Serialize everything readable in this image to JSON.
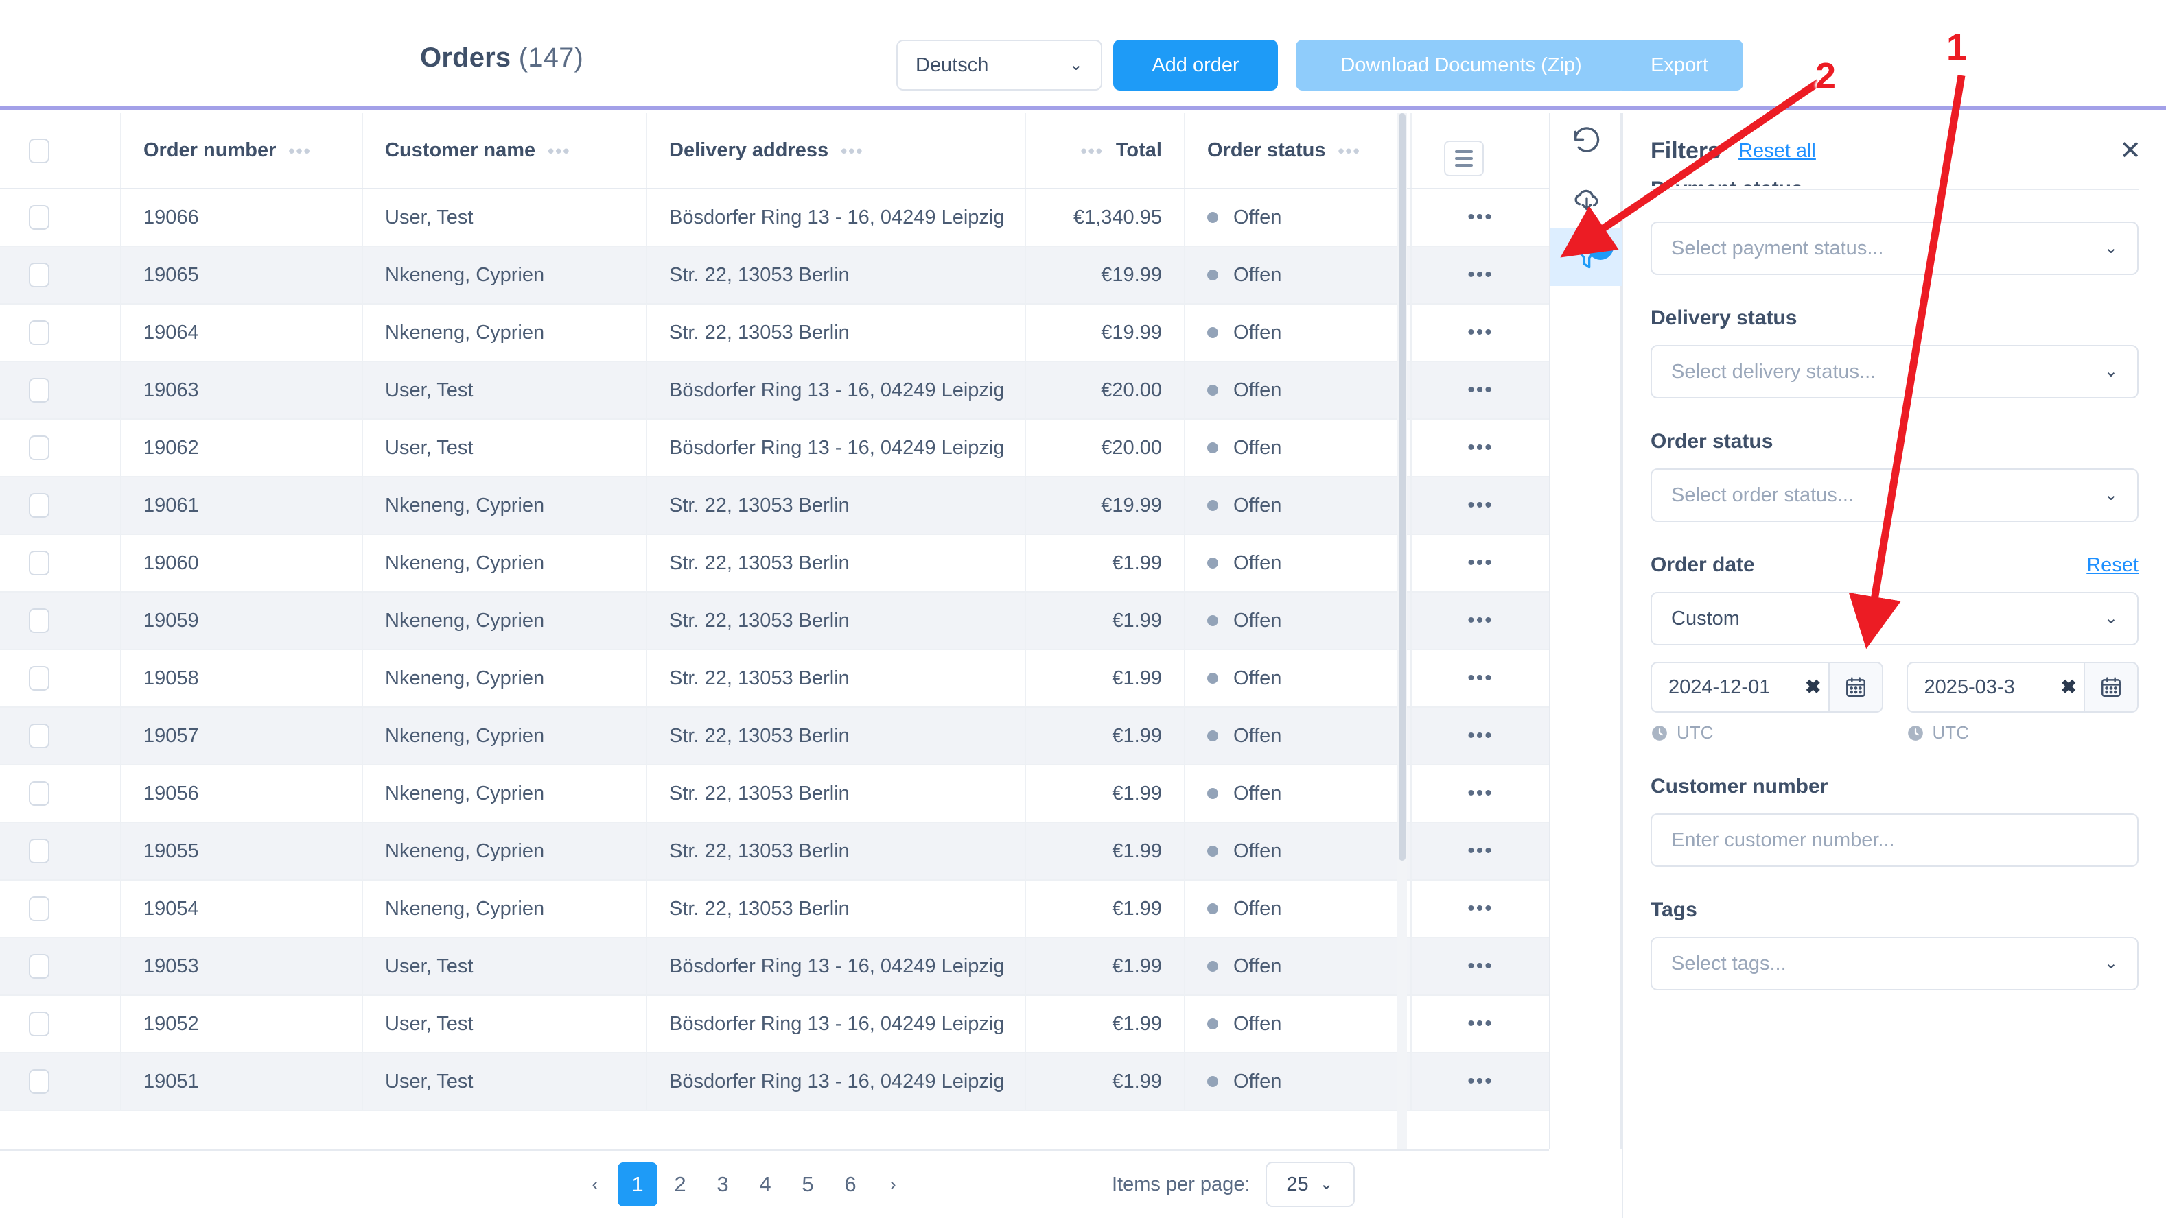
{
  "header": {
    "title": "Orders",
    "count": "(147)",
    "language_value": "Deutsch",
    "add_order_label": "Add order",
    "download_documents_label": "Download Documents (Zip)",
    "export_label": "Export",
    "accent_color": "#a3a0e8",
    "primary_color": "#1e9bf7",
    "soft_button_color": "#8fccfb"
  },
  "table": {
    "columns": [
      {
        "key": "check",
        "label": ""
      },
      {
        "key": "order",
        "label": "Order number"
      },
      {
        "key": "cust",
        "label": "Customer name"
      },
      {
        "key": "addr",
        "label": "Delivery address"
      },
      {
        "key": "total",
        "label": "Total"
      },
      {
        "key": "status",
        "label": "Order status"
      },
      {
        "key": "menu",
        "label": ""
      }
    ],
    "row_menu_icon": "ellipsis-icon",
    "column_settings_icon": "hamburger-icon",
    "rows": [
      {
        "order": "19066",
        "customer": "User, Test",
        "address": "Bösdorfer Ring 13 - 16, 04249 Leipzig",
        "total": "€1,340.95",
        "status": "Offen"
      },
      {
        "order": "19065",
        "customer": "Nkeneng, Cyprien",
        "address": "Str. 22, 13053 Berlin",
        "total": "€19.99",
        "status": "Offen"
      },
      {
        "order": "19064",
        "customer": "Nkeneng, Cyprien",
        "address": "Str. 22, 13053 Berlin",
        "total": "€19.99",
        "status": "Offen"
      },
      {
        "order": "19063",
        "customer": "User, Test",
        "address": "Bösdorfer Ring 13 - 16, 04249 Leipzig",
        "total": "€20.00",
        "status": "Offen"
      },
      {
        "order": "19062",
        "customer": "User, Test",
        "address": "Bösdorfer Ring 13 - 16, 04249 Leipzig",
        "total": "€20.00",
        "status": "Offen"
      },
      {
        "order": "19061",
        "customer": "Nkeneng, Cyprien",
        "address": "Str. 22, 13053 Berlin",
        "total": "€19.99",
        "status": "Offen"
      },
      {
        "order": "19060",
        "customer": "Nkeneng, Cyprien",
        "address": "Str. 22, 13053 Berlin",
        "total": "€1.99",
        "status": "Offen"
      },
      {
        "order": "19059",
        "customer": "Nkeneng, Cyprien",
        "address": "Str. 22, 13053 Berlin",
        "total": "€1.99",
        "status": "Offen"
      },
      {
        "order": "19058",
        "customer": "Nkeneng, Cyprien",
        "address": "Str. 22, 13053 Berlin",
        "total": "€1.99",
        "status": "Offen"
      },
      {
        "order": "19057",
        "customer": "Nkeneng, Cyprien",
        "address": "Str. 22, 13053 Berlin",
        "total": "€1.99",
        "status": "Offen"
      },
      {
        "order": "19056",
        "customer": "Nkeneng, Cyprien",
        "address": "Str. 22, 13053 Berlin",
        "total": "€1.99",
        "status": "Offen"
      },
      {
        "order": "19055",
        "customer": "Nkeneng, Cyprien",
        "address": "Str. 22, 13053 Berlin",
        "total": "€1.99",
        "status": "Offen"
      },
      {
        "order": "19054",
        "customer": "Nkeneng, Cyprien",
        "address": "Str. 22, 13053 Berlin",
        "total": "€1.99",
        "status": "Offen"
      },
      {
        "order": "19053",
        "customer": "User, Test",
        "address": "Bösdorfer Ring 13 - 16, 04249 Leipzig",
        "total": "€1.99",
        "status": "Offen"
      },
      {
        "order": "19052",
        "customer": "User, Test",
        "address": "Bösdorfer Ring 13 - 16, 04249 Leipzig",
        "total": "€1.99",
        "status": "Offen"
      },
      {
        "order": "19051",
        "customer": "User, Test",
        "address": "Bösdorfer Ring 13 - 16, 04249 Leipzig",
        "total": "€1.99",
        "status": "Offen"
      }
    ]
  },
  "rail": {
    "items": [
      {
        "icon": "refresh-icon",
        "active": false,
        "badge": ""
      },
      {
        "icon": "cloud-download-icon",
        "active": false,
        "badge": ""
      },
      {
        "icon": "filter-icon",
        "active": true,
        "badge": "1"
      }
    ],
    "badge_color": "#1e9bf7",
    "active_background": "#ddeeff"
  },
  "filters": {
    "title": "Filters",
    "reset_all_label": "Reset all",
    "close_icon": "close-icon",
    "payment_status": {
      "label": "Payment status",
      "placeholder": "Select payment status..."
    },
    "delivery_status": {
      "label": "Delivery status",
      "placeholder": "Select delivery status..."
    },
    "order_status": {
      "label": "Order status",
      "placeholder": "Select order status..."
    },
    "order_date": {
      "label": "Order date",
      "reset_label": "Reset",
      "preset_value": "Custom",
      "from_value": "2024-12-01",
      "to_value": "2025-03-3",
      "from_timezone": "UTC",
      "to_timezone": "UTC",
      "clear_icon": "clear-x-icon",
      "calendar_icon": "calendar-icon",
      "clock_icon": "clock-icon"
    },
    "customer_number": {
      "label": "Customer number",
      "placeholder": "Enter customer number..."
    },
    "tags": {
      "label": "Tags",
      "placeholder": "Select tags..."
    }
  },
  "pagination": {
    "prev_label": "‹",
    "next_label": "›",
    "pages": [
      "1",
      "2",
      "3",
      "4",
      "5",
      "6"
    ],
    "active_page": "1",
    "items_per_page_label": "Items per page:",
    "items_per_page_value": "25"
  },
  "annotations": {
    "markers": [
      {
        "id": "1",
        "label": "1"
      },
      {
        "id": "2",
        "label": "2"
      }
    ],
    "color": "#ec1c24"
  }
}
